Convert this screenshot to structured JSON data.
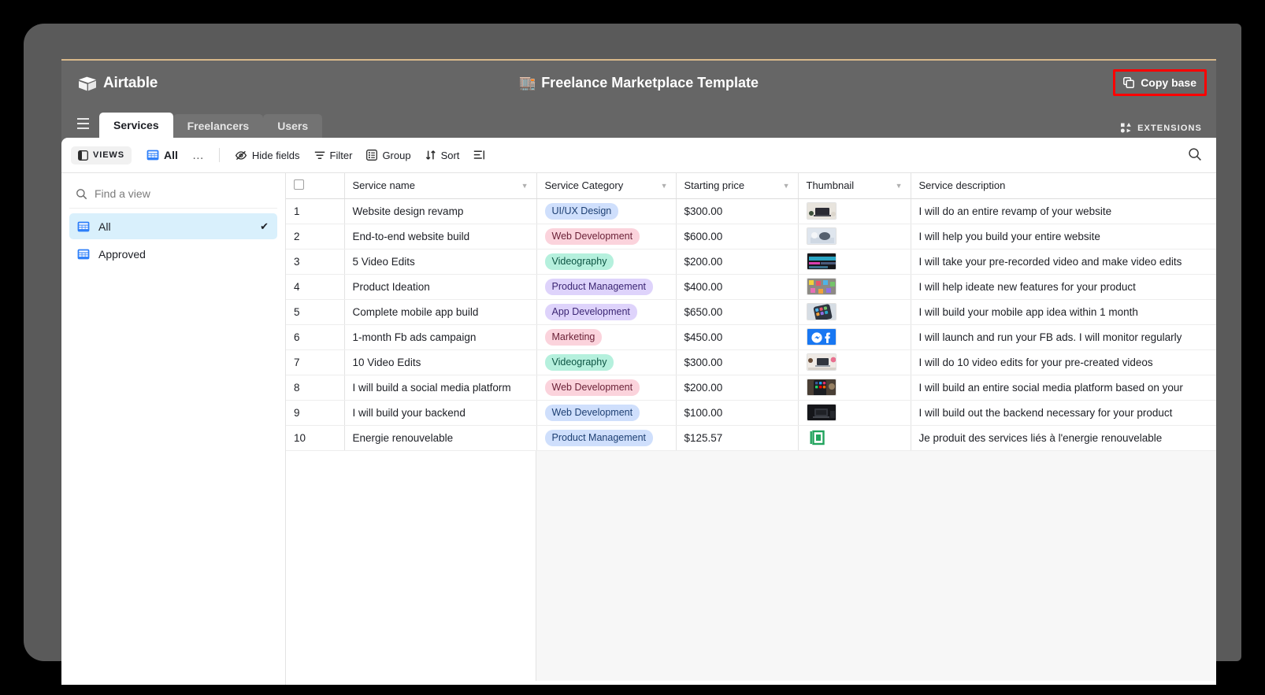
{
  "brand": {
    "name": "Airtable"
  },
  "header": {
    "title": "Freelance Marketplace Template",
    "title_emoji": "🏬",
    "copy_base_label": "Copy base",
    "copy_base_icon": "copy-icon",
    "highlight_color": "#ff0000"
  },
  "tabs": [
    {
      "label": "Services",
      "active": true
    },
    {
      "label": "Freelancers",
      "active": false
    },
    {
      "label": "Users",
      "active": false
    }
  ],
  "extensions": {
    "label": "EXTENSIONS",
    "icon": "extensions-icon"
  },
  "toolbar": {
    "views_label": "VIEWS",
    "views_icon": "sidebar-panel-icon",
    "current_view": "All",
    "current_view_icon": "grid-view-icon",
    "more_label": "…",
    "hide_fields_label": "Hide fields",
    "hide_fields_icon": "eye-slash-icon",
    "filter_label": "Filter",
    "filter_icon": "funnel-icon",
    "group_label": "Group",
    "group_icon": "group-icon",
    "sort_label": "Sort",
    "sort_icon": "sort-icon",
    "row_height_icon": "row-height-icon",
    "search_icon": "search-icon"
  },
  "sidebar": {
    "search_placeholder": "Find a view",
    "search_value": "",
    "search_icon": "search-icon",
    "views": [
      {
        "label": "All",
        "selected": true,
        "icon": "grid-view-icon",
        "check": "✔"
      },
      {
        "label": "Approved",
        "selected": false,
        "icon": "grid-view-icon",
        "check": ""
      }
    ]
  },
  "table": {
    "columns": [
      {
        "key": "rownum",
        "label": "",
        "caret": false
      },
      {
        "key": "name",
        "label": "Service name",
        "caret": true
      },
      {
        "key": "category",
        "label": "Service Category",
        "caret": true
      },
      {
        "key": "price",
        "label": "Starting price",
        "caret": true
      },
      {
        "key": "thumbnail",
        "label": "Thumbnail",
        "caret": true
      },
      {
        "key": "description",
        "label": "Service description",
        "caret": false
      }
    ],
    "rows": [
      {
        "num": "1",
        "name": "Website design revamp",
        "category": "UI/UX Design",
        "category_color": "blue",
        "price": "$300.00",
        "thumbnail": "desk-with-laptop-photo",
        "description": "I will do an entire revamp of your website"
      },
      {
        "num": "2",
        "name": "End-to-end website build",
        "category": "Web Development",
        "category_color": "pink",
        "price": "$600.00",
        "thumbnail": "person-typing-photo",
        "description": "I will help you build your entire website"
      },
      {
        "num": "3",
        "name": "5 Video Edits",
        "category": "Videography",
        "category_color": "green",
        "price": "$200.00",
        "thumbnail": "video-editor-screen-photo",
        "description": "I will take your pre-recorded video and make video edits"
      },
      {
        "num": "4",
        "name": "Product Ideation",
        "category": "Product Management",
        "category_color": "purple",
        "price": "$400.00",
        "thumbnail": "sticky-notes-photo",
        "description": "I will help ideate new features for your product"
      },
      {
        "num": "5",
        "name": "Complete mobile app build",
        "category": "App Development",
        "category_color": "purple",
        "price": "$650.00",
        "thumbnail": "smartphone-apps-photo",
        "description": "I will build your mobile app idea within 1 month"
      },
      {
        "num": "6",
        "name": "1-month Fb ads campaign",
        "category": "Marketing",
        "category_color": "pink",
        "price": "$450.00",
        "thumbnail": "facebook-messenger-logo",
        "description": "I will launch and run your FB ads. I will monitor regularly"
      },
      {
        "num": "7",
        "name": "10 Video Edits",
        "category": "Videography",
        "category_color": "green",
        "price": "$300.00",
        "thumbnail": "desk-workspace-photo",
        "description": "I will do 10 video edits for your pre-created videos"
      },
      {
        "num": "8",
        "name": "I will build a social media platform",
        "category": "Web Development",
        "category_color": "pink",
        "price": "$200.00",
        "thumbnail": "phone-social-apps-photo",
        "description": "I will build an entire social media platform based on your"
      },
      {
        "num": "9",
        "name": "I will build your backend",
        "category": "Web Development",
        "category_color": "blue",
        "price": "$100.00",
        "thumbnail": "dark-laptop-photo",
        "description": "I will build out the backend necessary for your product"
      },
      {
        "num": "10",
        "name": "Energie renouvelable",
        "category": "Product Management",
        "category_color": "blue",
        "price": "$125.57",
        "thumbnail": "green-file-icon",
        "description": "Je produit des services liés à l'energie renouvelable"
      }
    ]
  }
}
